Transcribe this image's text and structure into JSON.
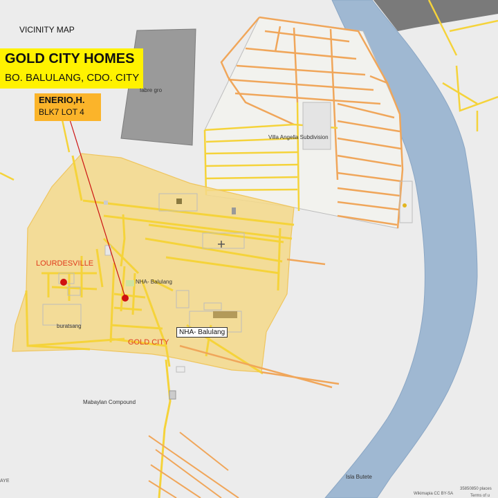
{
  "header": {
    "vicinity_map": "VICINITY MAP",
    "title": "GOLD CITY HOMES",
    "subtitle": "BO. BALULANG, CDO. CITY"
  },
  "owner": {
    "name": "ENERIO,H.",
    "lot": "BLK7 LOT  4"
  },
  "places": {
    "fabre_gro": "fabre gro",
    "villa_angela": "Villa Angella Subdivision",
    "lourdesville": "LOURDESVILLE",
    "nha_balulang": "NHA- Balulang",
    "buratsang": "buratsang",
    "gold_city": "GOLD CITY",
    "nha_callout": "NHA- Balulang",
    "mabaylan": "Mabaylan Compound",
    "isla_butete": "Isla Butete"
  },
  "footer": {
    "corner_left": "AYE",
    "attribution": "Wikimapia CC BY-SA",
    "places_count": "35850850 places",
    "terms": "Terms of u"
  },
  "colors": {
    "background": "#ececec",
    "river": "#9fb8d2",
    "area_fill": "#f5d98a",
    "road_yellow": "#f5d33a",
    "road_orange": "#f0a65a",
    "building": "#9a9a9a",
    "marker": "#d01010",
    "title_bg": "#fff200",
    "owner_bg": "#fbb42a"
  }
}
